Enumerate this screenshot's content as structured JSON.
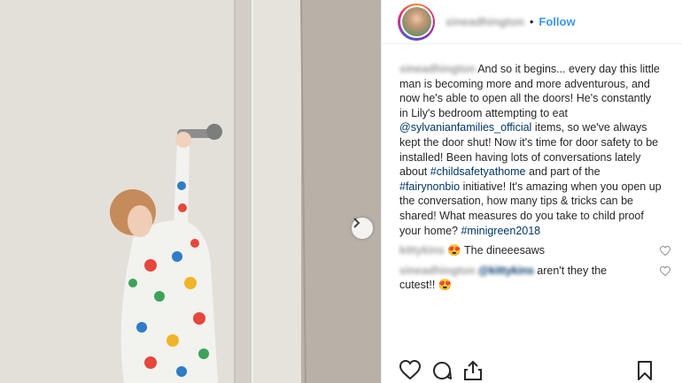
{
  "post": {
    "media_alt": "Toddler in dinosaur pajamas reaching up to open a white door handle",
    "next_icon": "chevron-right-icon"
  },
  "header": {
    "username": "sineadhington",
    "separator": "•",
    "follow_label": "Follow"
  },
  "caption": {
    "username": "sineadhington",
    "text_1": " And so it begins... every day this little man is becoming more and more adventurous, and now he's able to open all the doors! He's constantly in Lily's bedroom attempting to eat ",
    "mention_1": "@sylvanianfamilies_official",
    "text_2": " items, so we've always kept the door shut! Now it's time for door safety to be installed! Been having lots of conversations lately about ",
    "hashtag_1": "#childsafetyathome",
    "text_3": " and part of the ",
    "hashtag_2": "#fairynonbio",
    "text_4": " initiative! It's amazing when you open up the conversation, how many tips & tricks can be shared! What measures do you take to child proof your home? ",
    "hashtag_3": "#minigreen2018"
  },
  "comments": [
    {
      "username": "kittykins",
      "emoji": "😍",
      "text": " The dineeesaws"
    },
    {
      "username": "sineadhington",
      "mention": "@kittykins",
      "text": " aren't they the cutest!! ",
      "emoji": "😍"
    }
  ],
  "actions": {
    "like_icon": "heart-icon",
    "comment_icon": "comment-icon",
    "share_icon": "share-icon",
    "save_icon": "bookmark-icon"
  },
  "colors": {
    "link_blue": "#3897f0",
    "mention_navy": "#003569",
    "text": "#262626"
  }
}
